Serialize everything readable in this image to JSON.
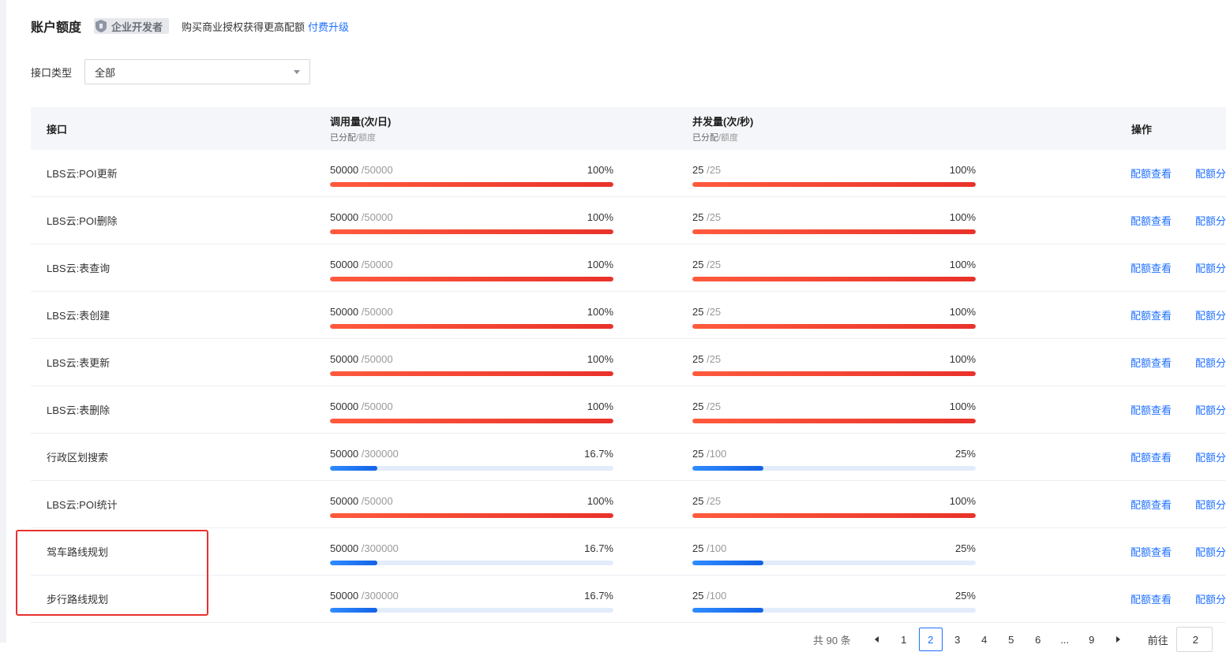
{
  "header": {
    "title": "账户额度",
    "badge": "企业开发者",
    "upgrade_text": "购买商业授权获得更高配额",
    "upgrade_link": "付费升级"
  },
  "filter": {
    "label": "接口类型",
    "value": "全部"
  },
  "table": {
    "columns": {
      "api": "接口",
      "calls": "调用量(次/日)",
      "calls_sub_main": "已分配",
      "calls_sub_dim": "/额度",
      "concurrency": "并发量(次/秒)",
      "conc_sub_main": "已分配",
      "conc_sub_dim": "/额度",
      "ops": "操作"
    },
    "rows": [
      {
        "name": "LBS云:POI更新",
        "calls_used": "50000",
        "calls_quota": "/50000",
        "calls_pct": "100%",
        "calls_ratio": 1.0,
        "conc_used": "25",
        "conc_quota": "/25",
        "conc_pct": "100%",
        "conc_ratio": 1.0,
        "op_view": "配额查看",
        "op_assign": "配额分"
      },
      {
        "name": "LBS云:POI删除",
        "calls_used": "50000",
        "calls_quota": "/50000",
        "calls_pct": "100%",
        "calls_ratio": 1.0,
        "conc_used": "25",
        "conc_quota": "/25",
        "conc_pct": "100%",
        "conc_ratio": 1.0,
        "op_view": "配额查看",
        "op_assign": "配额分"
      },
      {
        "name": "LBS云:表查询",
        "calls_used": "50000",
        "calls_quota": "/50000",
        "calls_pct": "100%",
        "calls_ratio": 1.0,
        "conc_used": "25",
        "conc_quota": "/25",
        "conc_pct": "100%",
        "conc_ratio": 1.0,
        "op_view": "配额查看",
        "op_assign": "配额分"
      },
      {
        "name": "LBS云:表创建",
        "calls_used": "50000",
        "calls_quota": "/50000",
        "calls_pct": "100%",
        "calls_ratio": 1.0,
        "conc_used": "25",
        "conc_quota": "/25",
        "conc_pct": "100%",
        "conc_ratio": 1.0,
        "op_view": "配额查看",
        "op_assign": "配额分"
      },
      {
        "name": "LBS云:表更新",
        "calls_used": "50000",
        "calls_quota": "/50000",
        "calls_pct": "100%",
        "calls_ratio": 1.0,
        "conc_used": "25",
        "conc_quota": "/25",
        "conc_pct": "100%",
        "conc_ratio": 1.0,
        "op_view": "配额查看",
        "op_assign": "配额分"
      },
      {
        "name": "LBS云:表删除",
        "calls_used": "50000",
        "calls_quota": "/50000",
        "calls_pct": "100%",
        "calls_ratio": 1.0,
        "conc_used": "25",
        "conc_quota": "/25",
        "conc_pct": "100%",
        "conc_ratio": 1.0,
        "op_view": "配额查看",
        "op_assign": "配额分"
      },
      {
        "name": "行政区划搜索",
        "calls_used": "50000",
        "calls_quota": "/300000",
        "calls_pct": "16.7%",
        "calls_ratio": 0.167,
        "conc_used": "25",
        "conc_quota": "/100",
        "conc_pct": "25%",
        "conc_ratio": 0.25,
        "op_view": "配额查看",
        "op_assign": "配额分"
      },
      {
        "name": "LBS云:POI统计",
        "calls_used": "50000",
        "calls_quota": "/50000",
        "calls_pct": "100%",
        "calls_ratio": 1.0,
        "conc_used": "25",
        "conc_quota": "/25",
        "conc_pct": "100%",
        "conc_ratio": 1.0,
        "op_view": "配额查看",
        "op_assign": "配额分"
      },
      {
        "name": "驾车路线规划",
        "calls_used": "50000",
        "calls_quota": "/300000",
        "calls_pct": "16.7%",
        "calls_ratio": 0.167,
        "conc_used": "25",
        "conc_quota": "/100",
        "conc_pct": "25%",
        "conc_ratio": 0.25,
        "op_view": "配额查看",
        "op_assign": "配额分"
      },
      {
        "name": "步行路线规划",
        "calls_used": "50000",
        "calls_quota": "/300000",
        "calls_pct": "16.7%",
        "calls_ratio": 0.167,
        "conc_used": "25",
        "conc_quota": "/100",
        "conc_pct": "25%",
        "conc_ratio": 0.25,
        "op_view": "配额查看",
        "op_assign": "配额分"
      }
    ]
  },
  "pagination": {
    "total": "共 90 条",
    "pages": [
      "1",
      "2",
      "3",
      "4",
      "5",
      "6",
      "...",
      "9"
    ],
    "current": "2",
    "goto_label": "前往",
    "goto_value": "2"
  },
  "colors": {
    "accent": "#1e6fff",
    "full_bar": "#e9322a",
    "partial_bar": "#1463e6",
    "highlight": "#e8302d"
  }
}
